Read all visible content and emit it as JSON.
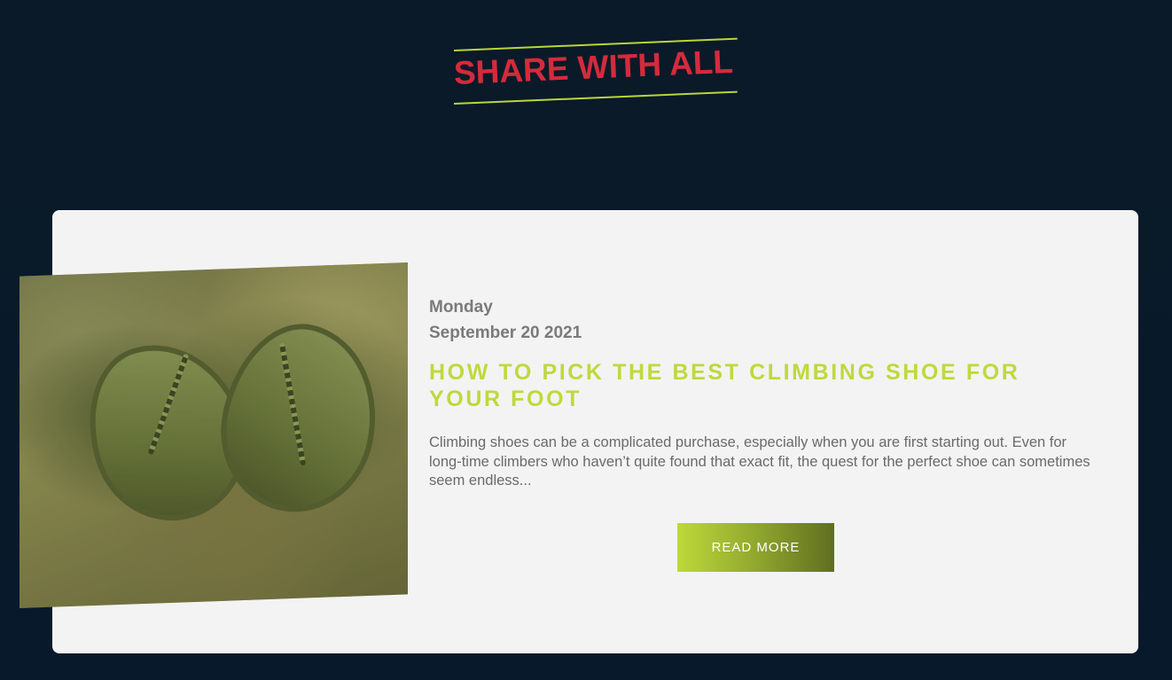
{
  "section": {
    "title": "SHARE WITH ALL"
  },
  "post": {
    "image_alt": "climbing-shoes-photo",
    "day": "Monday",
    "date": "September 20 2021",
    "title": "HOW TO PICK THE BEST CLIMBING SHOE FOR YOUR FOOT",
    "excerpt": "Climbing shoes can be a complicated purchase, especially when you are first starting out. Even for long-time climbers who haven’t quite found that exact fit, the quest for the perfect shoe can sometimes seem endless...",
    "read_more_label": "READ MORE"
  },
  "colors": {
    "background": "#0b1a28",
    "card": "#f3f3f3",
    "accent_green": "#bfd93b",
    "accent_red": "#d42b3c",
    "text_gray": "#6a6a6a"
  }
}
